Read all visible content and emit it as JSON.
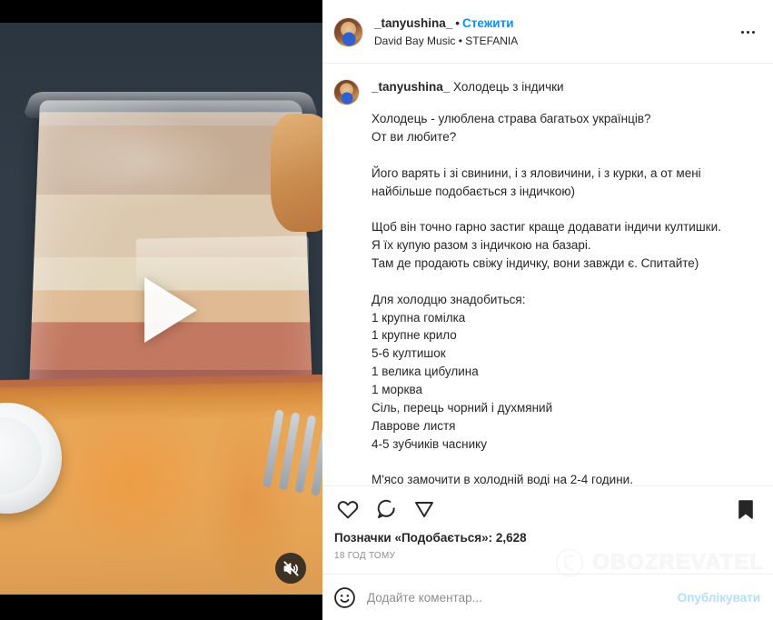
{
  "header": {
    "username": "_tanyushina_",
    "separator": "•",
    "follow_label": "Стежити",
    "music": "David Bay Music • STEFANIA",
    "more_icon": "more-options-icon"
  },
  "caption": {
    "username": "_tanyushina_",
    "title": "Холодець з індички",
    "body": "Холодець - улюблена страва багатьох українців?\nОт ви любите?\n\nЙого варять і зі свинини, і з яловичини, і з курки, а от мені\nнайбільше подобається з індичкою)\n\nЩоб він точно гарно застиг краще додавати індичи култишки.\nЯ їх купую разом з індичкою на базарі.\nТам де продають свіжу індичку, вони завжди є. Спитайте)\n\nДля холодцю знадобиться:\n1 крупна гомілка\n1 крупне крило\n5-6 култишок\n1 велика цибулина\n1 морква\nСіль, перець чорний і духмяний\nЛаврове листя\n4-5 зубчиків часнику\n\nМ'ясо замочити в холодній воді на 2-4 години."
  },
  "actions": {
    "like_icon": "heart-icon",
    "comment_icon": "comment-bubble-icon",
    "share_icon": "share-paper-plane-icon",
    "save_icon": "bookmark-filled-icon"
  },
  "stats": {
    "likes": "Позначки «Подобається»: 2,628",
    "timestamp": "18 ГОД ТОМУ"
  },
  "watermark": {
    "text": "OBOZREVATEL",
    "icon": "globe-hand-logo-icon"
  },
  "comment_bar": {
    "emoji_icon": "emoji-smiley-icon",
    "placeholder": "Додайте коментар...",
    "publish_label": "Опублікувати"
  },
  "media": {
    "play_icon": "play-triangle-icon",
    "mute_icon": "volume-muted-icon"
  },
  "colors": {
    "accent_blue": "#0095f6",
    "publish_blue": "#b2dffc",
    "text": "#262626",
    "muted": "#8e8e8e"
  }
}
